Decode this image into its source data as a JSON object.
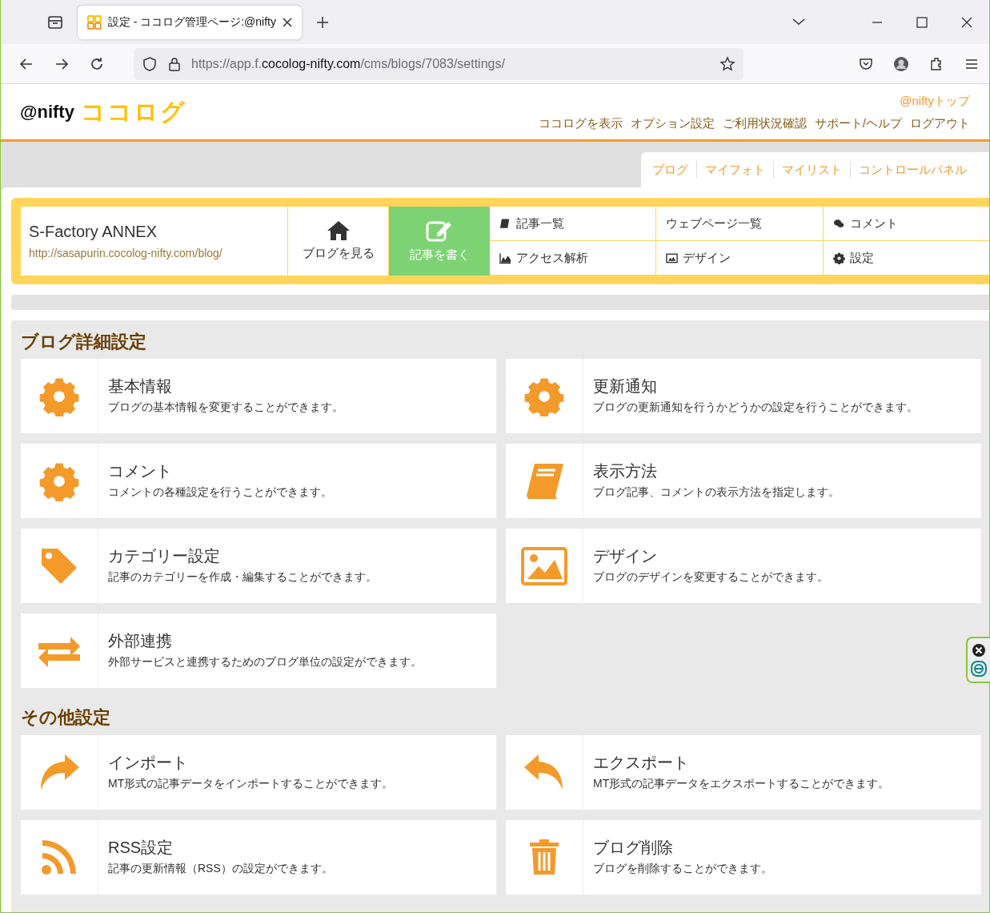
{
  "browser": {
    "tab_title": "設定 - ココログ管理ページ:@nifty",
    "url_prefix": "https://app.f.",
    "url_domain": "cocolog-nifty.com",
    "url_path": "/cms/blogs/7083/settings/"
  },
  "header": {
    "logo_brand": "@nifty",
    "logo_product": "ココログ",
    "top_link": "@niftyトップ",
    "nav": [
      "ココログを表示",
      "オプション設定",
      "ご利用状況確認",
      "サポート/ヘルプ",
      "ログアウト"
    ]
  },
  "service_tabs": [
    "ブログ",
    "マイフォト",
    "マイリスト",
    "コントロールパネル"
  ],
  "blog": {
    "name": "S-Factory ANNEX",
    "url": "http://sasapurin.cocolog-nifty.com/blog/",
    "view_button": "ブログを見る",
    "write_button": "記事を書く",
    "menu": [
      "記事一覧",
      "ウェブページ一覧",
      "コメント",
      "アクセス解析",
      "デザイン",
      "設定"
    ]
  },
  "sections": [
    {
      "title": "ブログ詳細設定",
      "cards": [
        {
          "title": "基本情報",
          "description": "ブログの基本情報を変更することができます。"
        },
        {
          "title": "更新通知",
          "description": "ブログの更新通知を行うかどうかの設定を行うことができます。"
        },
        {
          "title": "コメント",
          "description": "コメントの各種設定を行うことができます。"
        },
        {
          "title": "表示方法",
          "description": "ブログ記事、コメントの表示方法を指定します。"
        },
        {
          "title": "カテゴリー設定",
          "description": "記事のカテゴリーを作成・編集することができます。"
        },
        {
          "title": "デザイン",
          "description": "ブログのデザインを変更することができます。"
        },
        {
          "title": "外部連携",
          "description": "外部サービスと連携するためのブログ単位の設定ができます。"
        }
      ]
    },
    {
      "title": "その他設定",
      "cards": [
        {
          "title": "インポート",
          "description": "MT形式の記事データをインポートすることができます。"
        },
        {
          "title": "エクスポート",
          "description": "MT形式の記事データをエクスポートすることができます。"
        },
        {
          "title": "RSS設定",
          "description": "記事の更新情報（RSS）の設定ができます。"
        },
        {
          "title": "ブログ削除",
          "description": "ブログを削除することができます。"
        }
      ]
    }
  ]
}
